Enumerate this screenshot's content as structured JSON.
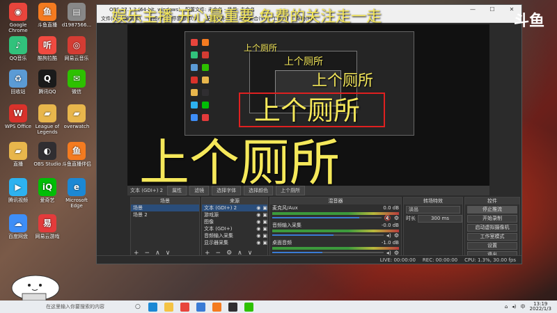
{
  "desktop": {
    "icons": [
      {
        "label": "Google Chrome",
        "icon": "chrome-icon",
        "color": "#e8453c",
        "glyph": "◉"
      },
      {
        "label": "斗鱼直播",
        "icon": "douyu-icon",
        "color": "#f47b20",
        "glyph": "鱼"
      },
      {
        "label": "d1987566...",
        "icon": "file-icon",
        "color": "#888888",
        "glyph": "▤"
      },
      {
        "label": "QQ音乐",
        "icon": "qq-music-icon",
        "color": "#31c27c",
        "glyph": "♪"
      },
      {
        "label": "酷狗拉酷",
        "icon": "kugou-icon",
        "color": "#f04a40",
        "glyph": "听"
      },
      {
        "label": "网易云音乐",
        "icon": "netease-music-icon",
        "color": "#d43c33",
        "glyph": "◎"
      },
      {
        "label": "回收站",
        "icon": "recycle-bin-icon",
        "color": "#5b9bd5",
        "glyph": "♻"
      },
      {
        "label": "腾讯QQ",
        "icon": "qq-icon",
        "color": "#1a1a1a",
        "glyph": "Q"
      },
      {
        "label": "微信",
        "icon": "wechat-icon",
        "color": "#2dc100",
        "glyph": "✉"
      },
      {
        "label": "WPS Office",
        "icon": "wps-icon",
        "color": "#d9322b",
        "glyph": "W"
      },
      {
        "label": "League of Legends",
        "icon": "folder-icon",
        "color": "#e8b64c",
        "glyph": "▰"
      },
      {
        "label": "overwatch",
        "icon": "folder-icon",
        "color": "#e8b64c",
        "glyph": "▰"
      },
      {
        "label": "直播",
        "icon": "folder-icon",
        "color": "#e8b64c",
        "glyph": "▰"
      },
      {
        "label": "OBS Studio",
        "icon": "obs-icon",
        "color": "#302e31",
        "glyph": "◐"
      },
      {
        "label": "斗鱼直播伴侣",
        "icon": "douyu-companion-icon",
        "color": "#f47b20",
        "glyph": "鱼"
      },
      {
        "label": "腾讯视频",
        "icon": "tencent-video-icon",
        "color": "#2db2f0",
        "glyph": "▶"
      },
      {
        "label": "爱奇艺",
        "icon": "iqiyi-icon",
        "color": "#00be06",
        "glyph": "iQ"
      },
      {
        "label": "Microsoft Edge",
        "icon": "edge-icon",
        "color": "#1c88d4",
        "glyph": "e"
      },
      {
        "label": "百度网盘",
        "icon": "baidu-netdisk-icon",
        "color": "#3e8ef7",
        "glyph": "☁"
      },
      {
        "label": "网易云游戏",
        "icon": "netease-game-icon",
        "color": "#e33b3b",
        "glyph": "易"
      }
    ]
  },
  "stream_overlay": {
    "top_banner": "娱乐主播 开心最重要 免费的关注走一走",
    "big_text": "上个厕所",
    "brand": "斗鱼"
  },
  "obs": {
    "title": "OBS 27.1.3 (64-bit, windows) - 配置文件: 未命名 - 场景: 未命名",
    "menu": [
      "文件(F)",
      "编辑(E)",
      "视图(V)",
      "停靠部件(D)",
      "配置文件(P)",
      "场景集合(S)",
      "工具(T)",
      "帮助(H)"
    ],
    "source_bar": {
      "current": "文本 (GDI+) 2",
      "tabs": [
        "属性",
        "滤镜",
        "选择字体",
        "选择颜色",
        "上个厕所"
      ]
    },
    "scenes": {
      "header": "场景",
      "items": [
        "场景",
        "场景 2"
      ]
    },
    "sources": {
      "header": "来源",
      "items": [
        "文本 (GDI+) 2",
        "游戏源",
        "图像",
        "文本 (GDI+)",
        "音频输入采集",
        "显示器采集"
      ]
    },
    "mixer": {
      "header": "混音器",
      "tracks": [
        {
          "name": "麦克风/Aux",
          "db": "0.0 dB",
          "level": 0.8,
          "muted": true
        },
        {
          "name": "音频输入采集",
          "db": "-0.0 dB",
          "level": 0.55,
          "muted": false
        },
        {
          "name": "桌面音频",
          "db": "-1.0 dB",
          "level": 0.45,
          "muted": false
        }
      ]
    },
    "transitions": {
      "header": "转场特效",
      "type": "淡出",
      "duration_label": "时长",
      "duration": "300 ms"
    },
    "controls": {
      "header": "控件",
      "buttons": [
        "停止推流",
        "开始录制",
        "启动虚拟摄像机",
        "工作室模式",
        "设置",
        "退出"
      ]
    },
    "status": {
      "live": "LIVE: 00:00:00",
      "rec": "REC: 00:00:00",
      "cpu": "CPU: 1.3%, 30.00 fps"
    }
  },
  "taskbar": {
    "search_placeholder": "在这里输入你要搜索的内容",
    "apps": [
      {
        "icon": "edge-taskbar-icon",
        "color": "#1c88d4"
      },
      {
        "icon": "explorer-icon",
        "color": "#f4c344"
      },
      {
        "icon": "chrome-taskbar-icon",
        "color": "#e8453c"
      },
      {
        "icon": "store-icon",
        "color": "#3a7bd5"
      },
      {
        "icon": "douyu-taskbar-icon",
        "color": "#f47b20"
      },
      {
        "icon": "obs-taskbar-icon",
        "color": "#302e31"
      },
      {
        "icon": "wechat-taskbar-icon",
        "color": "#2dc100"
      }
    ],
    "ime": "中",
    "time": "13:19",
    "date": "2022/1/3"
  }
}
